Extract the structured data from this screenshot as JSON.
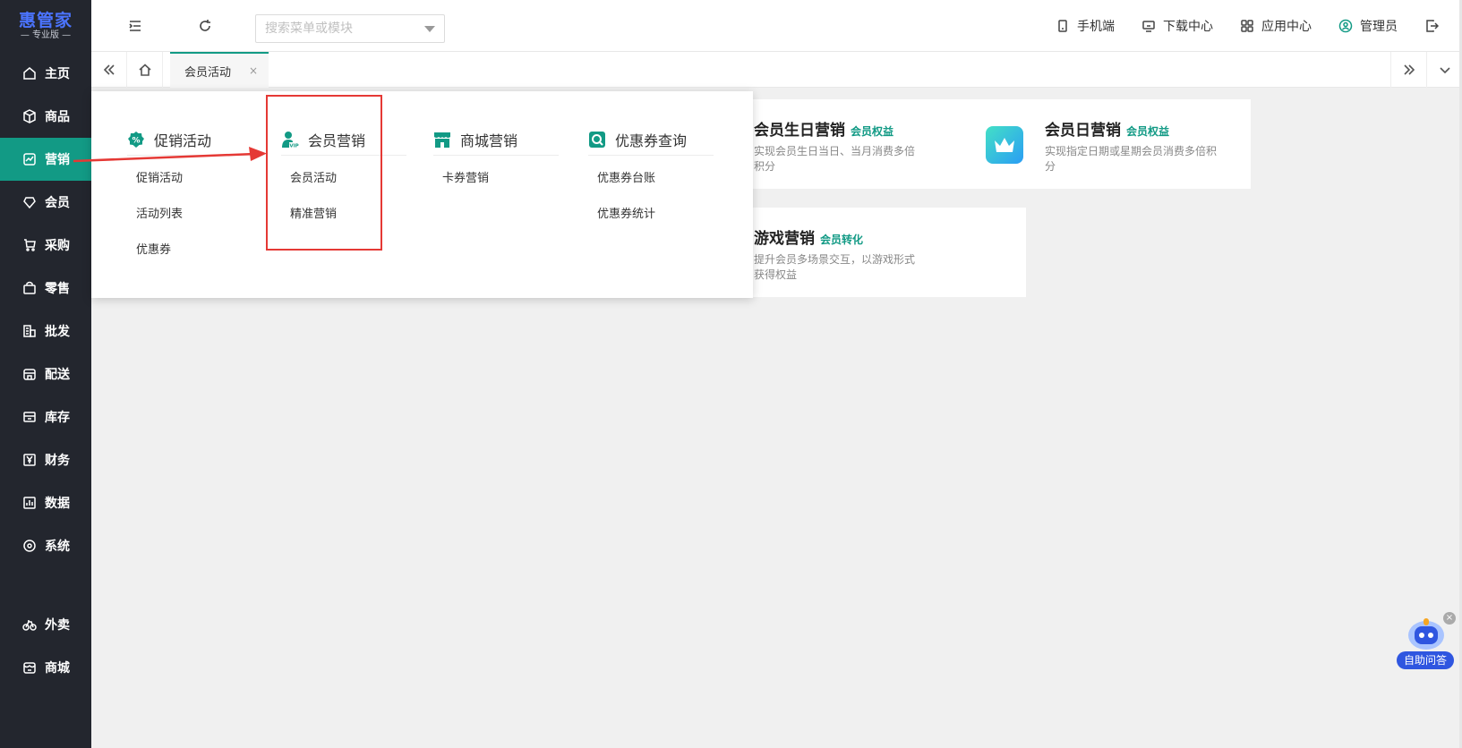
{
  "logo": {
    "name": "惠管家",
    "edition": "— 专业版 —"
  },
  "sidebar": {
    "items": [
      {
        "label": "主页",
        "icon": "home-icon"
      },
      {
        "label": "商品",
        "icon": "box-icon"
      },
      {
        "label": "营销",
        "icon": "chart-icon",
        "active": true
      },
      {
        "label": "会员",
        "icon": "heart-icon"
      },
      {
        "label": "采购",
        "icon": "cart-icon"
      },
      {
        "label": "零售",
        "icon": "bag-icon"
      },
      {
        "label": "批发",
        "icon": "building-icon"
      },
      {
        "label": "配送",
        "icon": "store-icon"
      },
      {
        "label": "库存",
        "icon": "inbox-icon"
      },
      {
        "label": "财务",
        "icon": "yen-icon"
      },
      {
        "label": "数据",
        "icon": "bar-icon"
      },
      {
        "label": "系统",
        "icon": "target-icon"
      }
    ],
    "bottom_items": [
      {
        "label": "外卖",
        "icon": "bike-icon"
      },
      {
        "label": "商城",
        "icon": "shop-icon"
      }
    ]
  },
  "header": {
    "search_placeholder": "搜索菜单或模块",
    "links": {
      "mobile": "手机端",
      "download": "下载中心",
      "apps": "应用中心",
      "user": "管理员"
    }
  },
  "tabs": {
    "active_label": "会员活动",
    "close_symbol": "×"
  },
  "cards": [
    {
      "title": "会员生日营销",
      "badge": "会员权益",
      "desc": "实现会员生日当日、当月消费多倍积分"
    },
    {
      "title": "会员日营销",
      "badge": "会员权益",
      "desc": "实现指定日期或星期会员消费多倍积分"
    },
    {
      "title": "游戏营销",
      "badge": "会员转化",
      "desc": "提升会员多场景交互，以游戏形式获得权益"
    }
  ],
  "mega_menu": {
    "columns": [
      {
        "heading": "促销活动",
        "items": [
          "促销活动",
          "活动列表",
          "优惠券"
        ]
      },
      {
        "heading": "会员营销",
        "items": [
          "会员活动",
          "精准营销"
        ]
      },
      {
        "heading": "商城营销",
        "items": [
          "卡券营销"
        ]
      },
      {
        "heading": "优惠券查询",
        "items": [
          "优惠券台账",
          "优惠券统计"
        ]
      }
    ]
  },
  "assistant": {
    "label": "自助问答",
    "close_symbol": "×"
  },
  "colors": {
    "accent": "#129a85",
    "sidebar_bg": "#23262e",
    "annotation_red": "#e53935"
  }
}
